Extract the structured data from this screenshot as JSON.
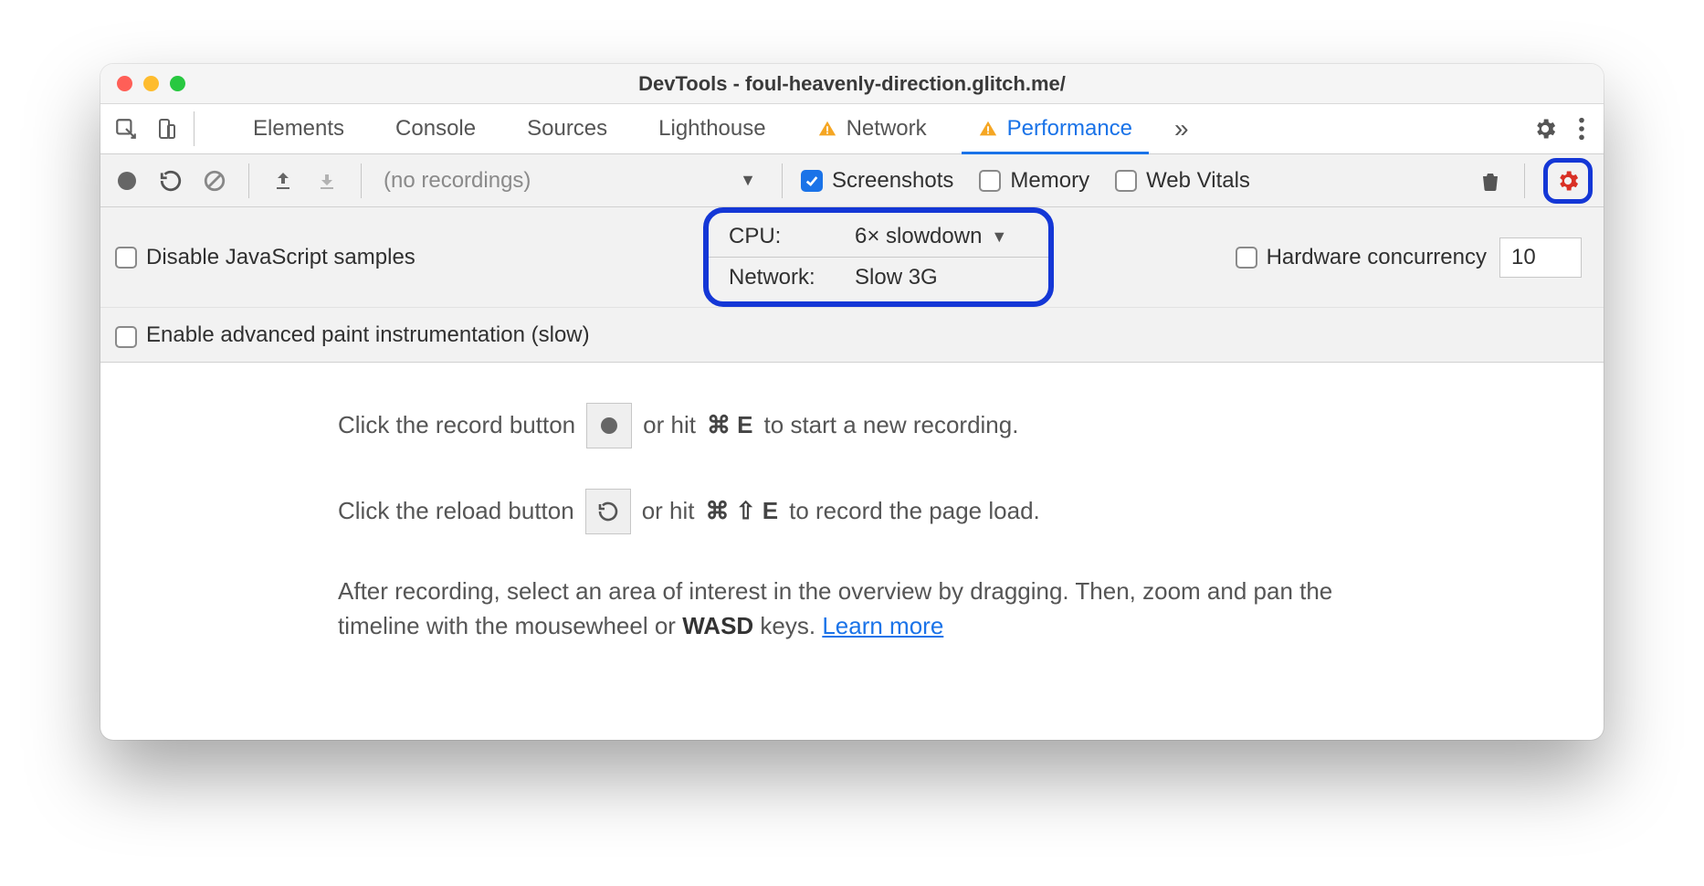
{
  "window": {
    "title": "DevTools - foul-heavenly-direction.glitch.me/"
  },
  "tabs": {
    "items": [
      {
        "label": "Elements",
        "warn": false,
        "active": false
      },
      {
        "label": "Console",
        "warn": false,
        "active": false
      },
      {
        "label": "Sources",
        "warn": false,
        "active": false
      },
      {
        "label": "Lighthouse",
        "warn": false,
        "active": false
      },
      {
        "label": "Network",
        "warn": true,
        "active": false
      },
      {
        "label": "Performance",
        "warn": true,
        "active": true
      }
    ],
    "more": "»"
  },
  "toolbar": {
    "recordings_label": "(no recordings)",
    "screenshots": {
      "label": "Screenshots",
      "checked": true
    },
    "memory": {
      "label": "Memory",
      "checked": false
    },
    "webvitals": {
      "label": "Web Vitals",
      "checked": false
    }
  },
  "settings": {
    "disable_js": {
      "label": "Disable JavaScript samples",
      "checked": false
    },
    "paint_instr": {
      "label": "Enable advanced paint instrumentation (slow)",
      "checked": false
    },
    "cpu": {
      "label": "CPU:",
      "value": "6× slowdown"
    },
    "network": {
      "label": "Network:",
      "value": "Slow 3G"
    },
    "hw_conc": {
      "label": "Hardware concurrency",
      "checked": false,
      "value": "10"
    }
  },
  "body": {
    "line1a": "Click the record button",
    "line1b": "or hit",
    "line1key": "⌘ E",
    "line1c": "to start a new recording.",
    "line2a": "Click the reload button",
    "line2b": "or hit",
    "line2key": "⌘ ⇧ E",
    "line2c": "to record the page load.",
    "line3a": "After recording, select an area of interest in the overview by dragging. Then, zoom and pan the timeline with the mousewheel or ",
    "line3b": "WASD",
    "line3c": " keys. ",
    "learn": "Learn more"
  }
}
